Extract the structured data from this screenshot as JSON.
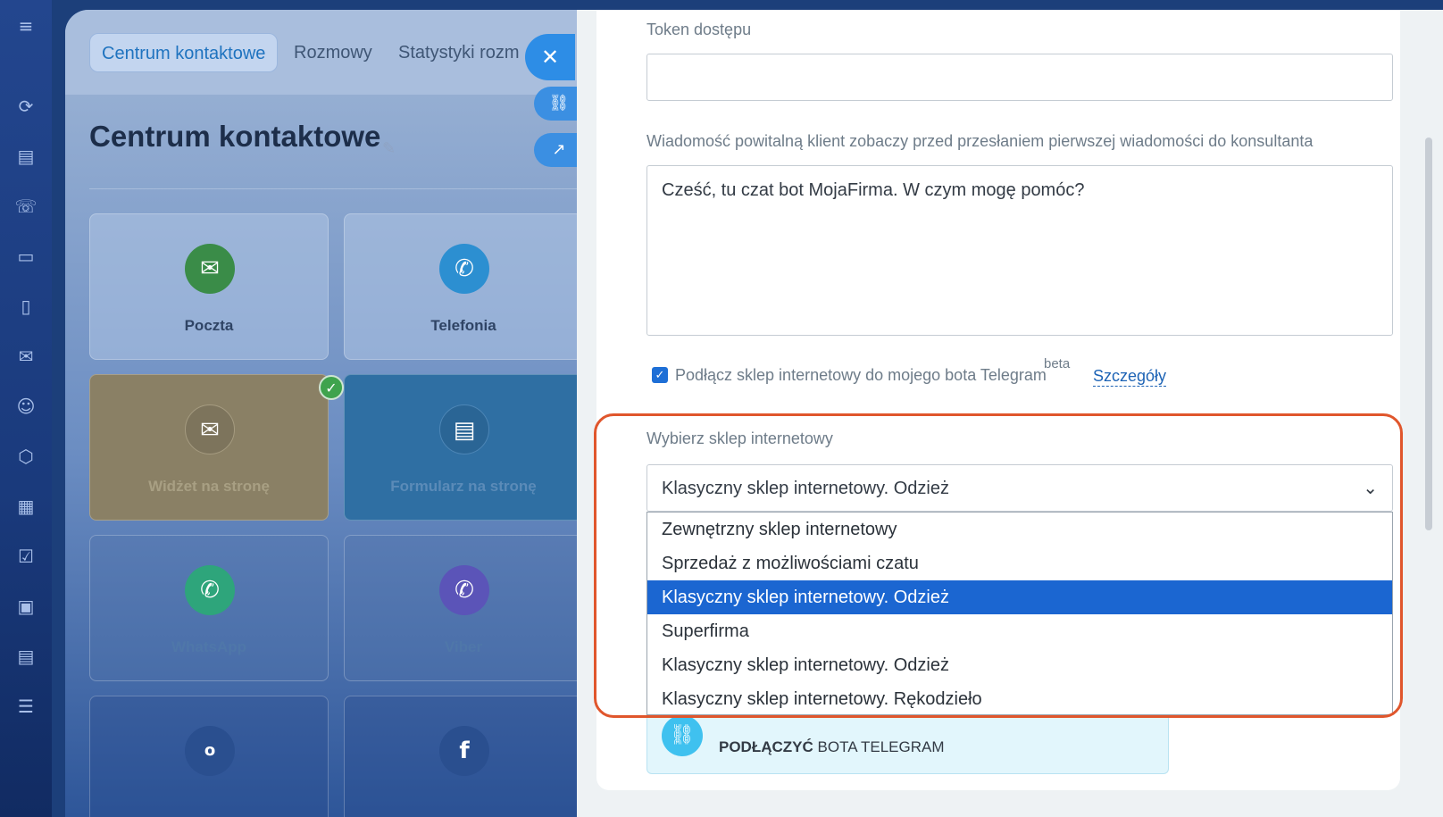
{
  "background": {
    "tabs": [
      "Centrum kontaktowe",
      "Rozmowy",
      "Statystyki rozm"
    ],
    "page_title": "Centrum kontaktowe",
    "tiles": [
      {
        "label": "Poczta",
        "icon": "mail-icon",
        "color": "#3a8c48"
      },
      {
        "label": "Telefonia",
        "icon": "phone-icon",
        "color": "#2c8fd1"
      },
      {
        "label": "Widżet na stronę",
        "icon": "chat-icon",
        "color": "#8a8065"
      },
      {
        "label": "Formularz na stronę",
        "icon": "form-icon",
        "color": "#2f6fa3"
      },
      {
        "label": "WhatsApp",
        "icon": "whatsapp-icon",
        "color": "#2ea57b"
      },
      {
        "label": "Viber",
        "icon": "viber-icon",
        "color": "#5b54b8"
      }
    ]
  },
  "panel": {
    "token_label": "Token dostępu",
    "token_value": "",
    "welcome_label": "Wiadomość powitalną klient zobaczy przed przesłaniem pierwszej wiadomości do konsultanta",
    "welcome_text": "Cześć, tu czat bot MojaFirma. W czym mogę pomóc?",
    "shop_checkbox_label": "Podłącz sklep internetowy do mojego bota Telegram",
    "shop_checkbox_checked": true,
    "beta_label": "beta",
    "details_link": "Szczegóły",
    "shop_select_label": "Wybierz sklep internetowy",
    "shop_select_value": "Klasyczny sklep internetowy. Odzież",
    "shop_options": [
      "Zewnętrzny sklep internetowy",
      "Sprzedaż z możliwościami czatu",
      "Klasyczny sklep internetowy. Odzież",
      "Superfirma",
      "Klasyczny sklep internetowy. Odzież",
      "Klasyczny sklep internetowy. Rękodzieło"
    ],
    "selected_option_index": 2,
    "connect_bold": "PODŁĄCZYĆ",
    "connect_rest": " BOTA TELEGRAM"
  },
  "colors": {
    "accent": "#1b66d1",
    "highlight_frame": "#e0562c",
    "checkbox": "#1e6fd6"
  }
}
